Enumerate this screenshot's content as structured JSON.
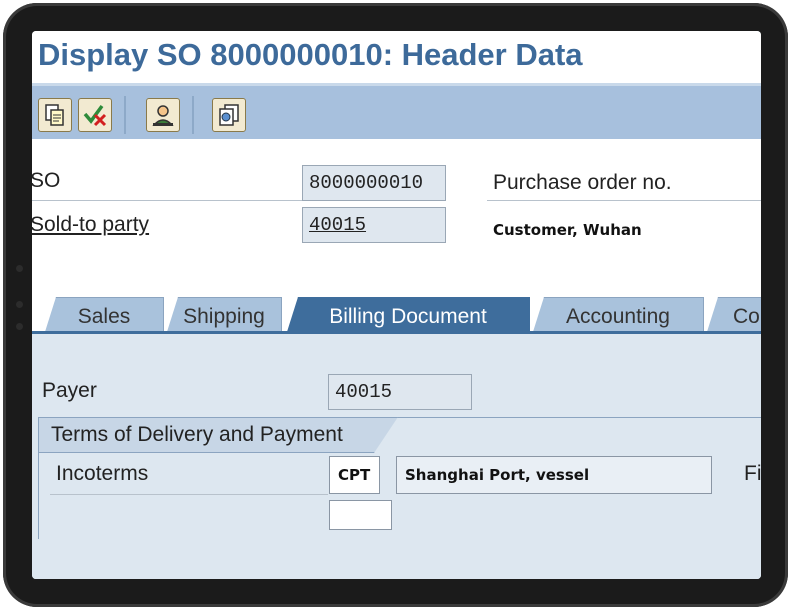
{
  "window": {
    "title": "Display SO 8000000010: Header Data"
  },
  "toolbar": {
    "buttons": [
      {
        "icon": "document-copy-icon"
      },
      {
        "icon": "check-cancel-icon"
      },
      {
        "icon": "person-icon"
      },
      {
        "icon": "document-flow-icon"
      }
    ]
  },
  "header": {
    "so_label": "SO",
    "so_value": "8000000010",
    "po_label": "Purchase order no.",
    "sold_to_label": "Sold-to party",
    "sold_to_value": "40015",
    "sold_to_desc": "Customer, Wuhan"
  },
  "tabs": [
    {
      "label": "Sales",
      "active": false
    },
    {
      "label": "Shipping",
      "active": false
    },
    {
      "label": "Billing Document",
      "active": true
    },
    {
      "label": "Accounting",
      "active": false
    },
    {
      "label": "Co",
      "active": false
    }
  ],
  "billing": {
    "payer_label": "Payer",
    "payer_value": "40015",
    "group_title": "Terms of Delivery and Payment",
    "incoterms_label": "Incoterms",
    "incoterms_code": "CPT",
    "incoterms_desc": "Shanghai Port, vessel",
    "next_label": "Fi"
  },
  "colors": {
    "title": "#3d6a9a",
    "toolbar": "#a7c0dd",
    "tab_active": "#3e6d9c",
    "tab_inactive": "#a9c2dc",
    "body_bg": "#dde7f0"
  }
}
